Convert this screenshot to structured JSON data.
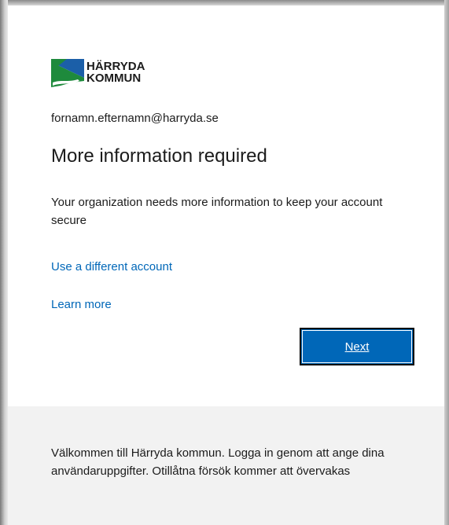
{
  "logo": {
    "line1": "HÄRRYDA",
    "line2": "KOMMUN",
    "colors": {
      "green": "#1e8a3c",
      "blue": "#1b5fa8",
      "dark": "#1b1b1b"
    }
  },
  "account": {
    "email": "fornamn.efternamn@harryda.se"
  },
  "main": {
    "title": "More information required",
    "description": "Your organization needs more information to keep your account secure",
    "use_different_account": "Use a different account",
    "learn_more": "Learn more",
    "next_label": "Next"
  },
  "footer": {
    "text": "Välkommen till Härryda kommun. Logga in genom att ange dina användaruppgifter. Otillåtna försök kommer att övervakas"
  },
  "colors": {
    "accent": "#0067b8",
    "footer_bg": "#f2f2f2",
    "text": "#1b1b1b"
  }
}
